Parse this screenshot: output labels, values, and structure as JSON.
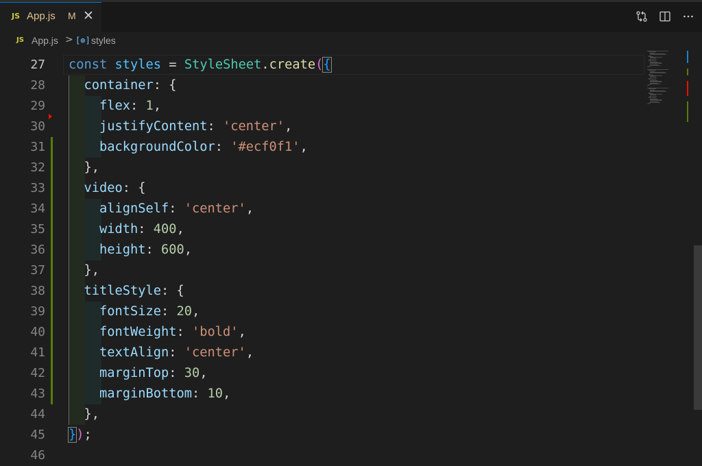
{
  "tab": {
    "badge": "JS",
    "label": "App.js",
    "modified": "M",
    "close_glyph": "✕"
  },
  "tab_actions": [
    {
      "name": "open-changes-icon"
    },
    {
      "name": "split-editor-icon"
    },
    {
      "name": "more-actions-icon"
    }
  ],
  "breadcrumb": {
    "badge": "JS",
    "file": "App.js",
    "separator": ">",
    "symbol_icon": "[⊚]",
    "symbol": "styles"
  },
  "editor": {
    "current_line": 27,
    "lines": [
      {
        "n": "27",
        "tokens": [
          [
            "k",
            "const"
          ],
          [
            "p",
            " "
          ],
          [
            "c",
            "styles"
          ],
          [
            "p",
            " = "
          ],
          [
            "t",
            "StyleSheet"
          ],
          [
            "p",
            "."
          ],
          [
            "f",
            "create"
          ],
          [
            "b1",
            "("
          ],
          [
            "b2",
            "{"
          ]
        ]
      },
      {
        "n": "28",
        "tokens": [
          [
            "p",
            "  "
          ],
          [
            "v",
            "container"
          ],
          [
            "p",
            ": {"
          ]
        ]
      },
      {
        "n": "29",
        "tokens": [
          [
            "p",
            "    "
          ],
          [
            "v",
            "flex"
          ],
          [
            "p",
            ": "
          ],
          [
            "n",
            "1"
          ],
          [
            "p",
            ","
          ]
        ]
      },
      {
        "n": "30",
        "tokens": [
          [
            "p",
            "    "
          ],
          [
            "v",
            "justifyContent"
          ],
          [
            "p",
            ": "
          ],
          [
            "s",
            "'center'"
          ],
          [
            "p",
            ","
          ]
        ]
      },
      {
        "n": "31",
        "tokens": [
          [
            "p",
            "    "
          ],
          [
            "v",
            "backgroundColor"
          ],
          [
            "p",
            ": "
          ],
          [
            "s",
            "'#ecf0f1'"
          ],
          [
            "p",
            ","
          ]
        ]
      },
      {
        "n": "32",
        "tokens": [
          [
            "p",
            "  },"
          ]
        ]
      },
      {
        "n": "33",
        "tokens": [
          [
            "p",
            "  "
          ],
          [
            "v",
            "video"
          ],
          [
            "p",
            ": {"
          ]
        ]
      },
      {
        "n": "34",
        "tokens": [
          [
            "p",
            "    "
          ],
          [
            "v",
            "alignSelf"
          ],
          [
            "p",
            ": "
          ],
          [
            "s",
            "'center'"
          ],
          [
            "p",
            ","
          ]
        ]
      },
      {
        "n": "35",
        "tokens": [
          [
            "p",
            "    "
          ],
          [
            "v",
            "width"
          ],
          [
            "p",
            ": "
          ],
          [
            "n",
            "400"
          ],
          [
            "p",
            ","
          ]
        ]
      },
      {
        "n": "36",
        "tokens": [
          [
            "p",
            "    "
          ],
          [
            "v",
            "height"
          ],
          [
            "p",
            ": "
          ],
          [
            "n",
            "600"
          ],
          [
            "p",
            ","
          ]
        ]
      },
      {
        "n": "37",
        "tokens": [
          [
            "p",
            "  },"
          ]
        ]
      },
      {
        "n": "38",
        "tokens": [
          [
            "p",
            "  "
          ],
          [
            "v",
            "titleStyle"
          ],
          [
            "p",
            ": {"
          ]
        ]
      },
      {
        "n": "39",
        "tokens": [
          [
            "p",
            "    "
          ],
          [
            "v",
            "fontSize"
          ],
          [
            "p",
            ": "
          ],
          [
            "n",
            "20"
          ],
          [
            "p",
            ","
          ]
        ]
      },
      {
        "n": "40",
        "tokens": [
          [
            "p",
            "    "
          ],
          [
            "v",
            "fontWeight"
          ],
          [
            "p",
            ": "
          ],
          [
            "s",
            "'bold'"
          ],
          [
            "p",
            ","
          ]
        ]
      },
      {
        "n": "41",
        "tokens": [
          [
            "p",
            "    "
          ],
          [
            "v",
            "textAlign"
          ],
          [
            "p",
            ": "
          ],
          [
            "s",
            "'center'"
          ],
          [
            "p",
            ","
          ]
        ]
      },
      {
        "n": "42",
        "tokens": [
          [
            "p",
            "    "
          ],
          [
            "v",
            "marginTop"
          ],
          [
            "p",
            ": "
          ],
          [
            "n",
            "30"
          ],
          [
            "p",
            ","
          ]
        ]
      },
      {
        "n": "43",
        "tokens": [
          [
            "p",
            "    "
          ],
          [
            "v",
            "marginBottom"
          ],
          [
            "p",
            ": "
          ],
          [
            "n",
            "10"
          ],
          [
            "p",
            ","
          ]
        ]
      },
      {
        "n": "44",
        "tokens": [
          [
            "p",
            "  },"
          ]
        ]
      },
      {
        "n": "45",
        "tokens": [
          [
            "b2",
            "}"
          ],
          [
            "b1",
            ")"
          ],
          [
            "p",
            ";"
          ]
        ]
      },
      {
        "n": "46",
        "tokens": []
      }
    ],
    "modified_lines": [
      31,
      32,
      33,
      34,
      35,
      36,
      37,
      38,
      39,
      40,
      41,
      42,
      43
    ],
    "deleted_marker_after_line": 30
  },
  "colors": {
    "editor_bg": "#1e1e1e",
    "modified_tab_text": "#e2c08d",
    "js_badge": "#cbcb41",
    "git_added": "#587c0c",
    "git_deleted": "#e51400"
  }
}
